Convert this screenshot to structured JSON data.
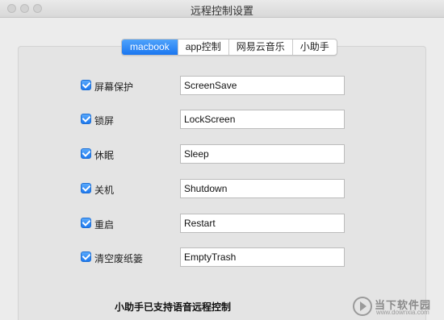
{
  "window": {
    "title": "远程控制设置"
  },
  "tabs": [
    {
      "label": "macbook",
      "active": true
    },
    {
      "label": "app控制",
      "active": false
    },
    {
      "label": "网易云音乐",
      "active": false
    },
    {
      "label": "小助手",
      "active": false
    }
  ],
  "settings": [
    {
      "label": "屏幕保护",
      "checked": true,
      "value": "ScreenSave"
    },
    {
      "label": "锁屏",
      "checked": true,
      "value": "LockScreen"
    },
    {
      "label": "休眠",
      "checked": true,
      "value": "Sleep"
    },
    {
      "label": "关机",
      "checked": true,
      "value": "Shutdown"
    },
    {
      "label": "重启",
      "checked": true,
      "value": "Restart"
    },
    {
      "label": "清空废纸篓",
      "checked": true,
      "value": "EmptyTrash"
    }
  ],
  "footer": {
    "text": "小助手已支持语音远程控制"
  },
  "watermark": {
    "name": "当下软件园",
    "url": "www.downxia.com"
  },
  "colors": {
    "accent": "#1a76f0",
    "background": "#ececec",
    "panel": "#e4e4e4"
  }
}
